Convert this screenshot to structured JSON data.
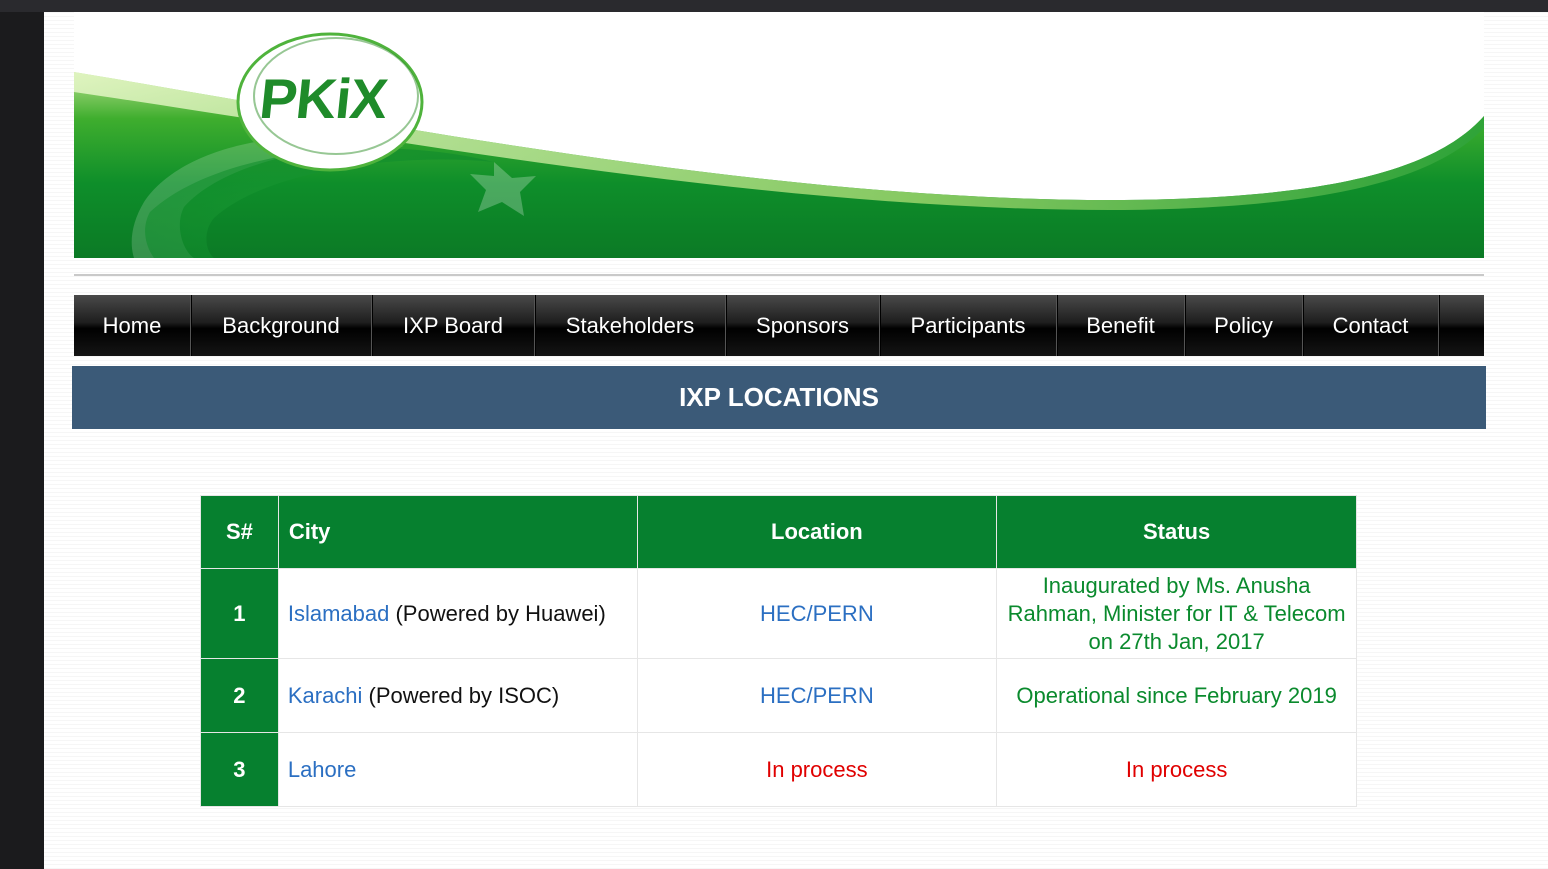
{
  "logo": {
    "text": "PKiX"
  },
  "nav": {
    "items": [
      {
        "label": "Home"
      },
      {
        "label": "Background"
      },
      {
        "label": "IXP Board"
      },
      {
        "label": "Stakeholders"
      },
      {
        "label": "Sponsors"
      },
      {
        "label": "Participants"
      },
      {
        "label": "Benefit"
      },
      {
        "label": "Policy"
      },
      {
        "label": "Contact"
      }
    ]
  },
  "section": {
    "title": "IXP LOCATIONS"
  },
  "table": {
    "headers": {
      "sn": "S#",
      "city": "City",
      "location": "Location",
      "status": "Status"
    },
    "rows": [
      {
        "sn": "1",
        "city_link": "Islamabad",
        "city_note": " (Powered by Huawei)",
        "location": "HEC/PERN",
        "status": "Inaugurated by Ms. Anusha Rahman, Minister for IT & Telecom on 27th Jan, 2017"
      },
      {
        "sn": "2",
        "city_link": "Karachi",
        "city_note": " (Powered by ISOC)",
        "location": "HEC/PERN",
        "status": "Operational since February 2019"
      },
      {
        "sn": "3",
        "city_link": "Lahore",
        "city_note": "",
        "location": "In process",
        "status": "In process"
      }
    ]
  },
  "colors": {
    "nav_bg": "#111111",
    "title_bar": "#3b5a78",
    "table_green": "#06802f",
    "link_blue": "#2b6fc2",
    "status_green": "#0a8a2d",
    "status_red": "#e00000"
  }
}
